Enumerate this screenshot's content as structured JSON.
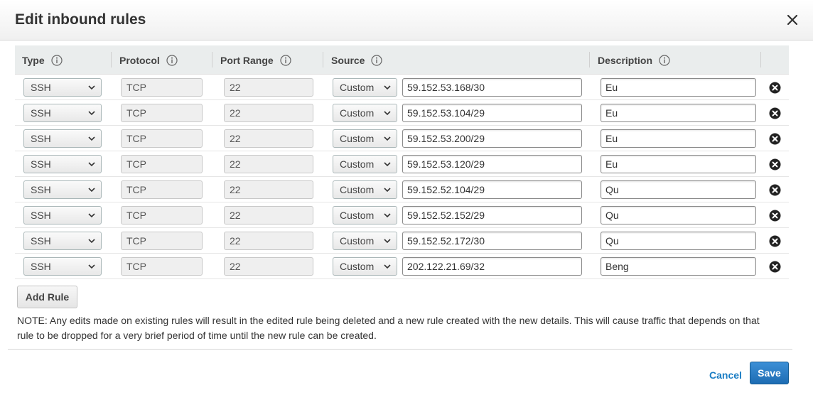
{
  "dialog": {
    "title": "Edit inbound rules",
    "close_icon": "close-icon"
  },
  "columns": {
    "type": "Type",
    "protocol": "Protocol",
    "port_range": "Port Range",
    "source": "Source",
    "description": "Description",
    "info_icon": "info-icon"
  },
  "rules": [
    {
      "type": "SSH",
      "protocol": "TCP",
      "port": "22",
      "source_type": "Custom",
      "cidr": "59.152.53.168/30",
      "description": "Eu"
    },
    {
      "type": "SSH",
      "protocol": "TCP",
      "port": "22",
      "source_type": "Custom",
      "cidr": "59.152.53.104/29",
      "description": "Eu"
    },
    {
      "type": "SSH",
      "protocol": "TCP",
      "port": "22",
      "source_type": "Custom",
      "cidr": "59.152.53.200/29",
      "description": "Eu"
    },
    {
      "type": "SSH",
      "protocol": "TCP",
      "port": "22",
      "source_type": "Custom",
      "cidr": "59.152.53.120/29",
      "description": "Eu"
    },
    {
      "type": "SSH",
      "protocol": "TCP",
      "port": "22",
      "source_type": "Custom",
      "cidr": "59.152.52.104/29",
      "description": "Qu"
    },
    {
      "type": "SSH",
      "protocol": "TCP",
      "port": "22",
      "source_type": "Custom",
      "cidr": "59.152.52.152/29",
      "description": "Qu"
    },
    {
      "type": "SSH",
      "protocol": "TCP",
      "port": "22",
      "source_type": "Custom",
      "cidr": "59.152.52.172/30",
      "description": "Qu"
    },
    {
      "type": "SSH",
      "protocol": "TCP",
      "port": "22",
      "source_type": "Custom",
      "cidr": "202.122.21.69/32",
      "description": "Beng"
    }
  ],
  "add_rule_label": "Add Rule",
  "note": "NOTE: Any edits made on existing rules will result in the edited rule being deleted and a new rule created with the new details. This will cause traffic that depends on that rule to be dropped for a very brief period of time until the new rule can be created.",
  "footer": {
    "cancel_label": "Cancel",
    "save_label": "Save"
  },
  "colors": {
    "primary_button": "#1d6cb3",
    "link": "#1a7dc4",
    "header_bg": "#eaeded"
  }
}
